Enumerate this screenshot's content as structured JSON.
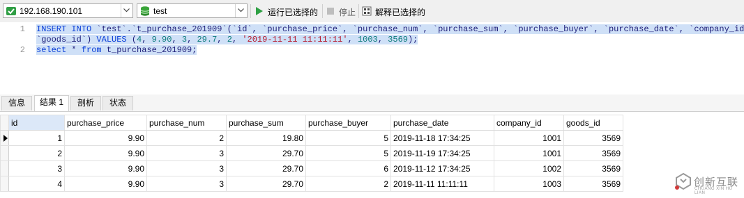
{
  "toolbar": {
    "connection_value": "192.168.190.101",
    "database_value": "test",
    "run_selected_label": "运行已选择的",
    "stop_label": "停止",
    "explain_selected_label": "解释已选择的",
    "connection_icon": "connection-icon",
    "database_icon": "database-icon",
    "colors": {
      "run_green": "#2ea043",
      "db_green": "#3aa53a"
    }
  },
  "editor": {
    "line_numbers": [
      "1",
      "",
      "2"
    ],
    "line1": {
      "kw1": "INSERT INTO",
      "t1": " `test`.`t_purchase_201909`(`id`, `purchase_price`, `purchase_num`, `purchase_sum`, `purchase_buyer`, `purchase_date`, `company_id`,"
    },
    "line1b": {
      "t1": "`goods_id`) ",
      "kw1": "VALUES",
      "p1": " (",
      "n1": "4",
      "p2": ", ",
      "n2": "9.90",
      "p3": ", ",
      "n3": "3",
      "p4": ", ",
      "n4": "29.7",
      "p5": ", ",
      "n5": "2",
      "p6": ", ",
      "s1": "'2019-11-11 11:11:11'",
      "p7": ", ",
      "n6": "1003",
      "p8": ", ",
      "n7": "3569",
      "p9": ");"
    },
    "line2": {
      "kw1": "select",
      "p1": " * ",
      "kw2": "from",
      "t1": " t_purchase_201909;"
    },
    "selection_color": "#cfe0f7"
  },
  "result_tabs": [
    {
      "label": "信息"
    },
    {
      "label": "结果 1"
    },
    {
      "label": "剖析"
    },
    {
      "label": "状态"
    }
  ],
  "grid": {
    "columns": [
      "id",
      "purchase_price",
      "purchase_num",
      "purchase_sum",
      "purchase_buyer",
      "purchase_date",
      "company_id",
      "goods_id"
    ],
    "rows": [
      [
        "1",
        "9.90",
        "2",
        "19.80",
        "5",
        "2019-11-18 17:34:25",
        "1001",
        "3569"
      ],
      [
        "2",
        "9.90",
        "3",
        "29.70",
        "5",
        "2019-11-19 17:34:25",
        "1001",
        "3569"
      ],
      [
        "3",
        "9.90",
        "3",
        "29.70",
        "6",
        "2019-11-12 17:34:25",
        "1002",
        "3569"
      ],
      [
        "4",
        "9.90",
        "3",
        "29.70",
        "2",
        "2019-11-11 11:11:11",
        "1003",
        "3569"
      ]
    ],
    "current_row_indicator": "row-pointer-icon"
  },
  "watermark": {
    "text_cn": "创新互联",
    "text_en": "CHUANG XIN HU LIAN"
  }
}
